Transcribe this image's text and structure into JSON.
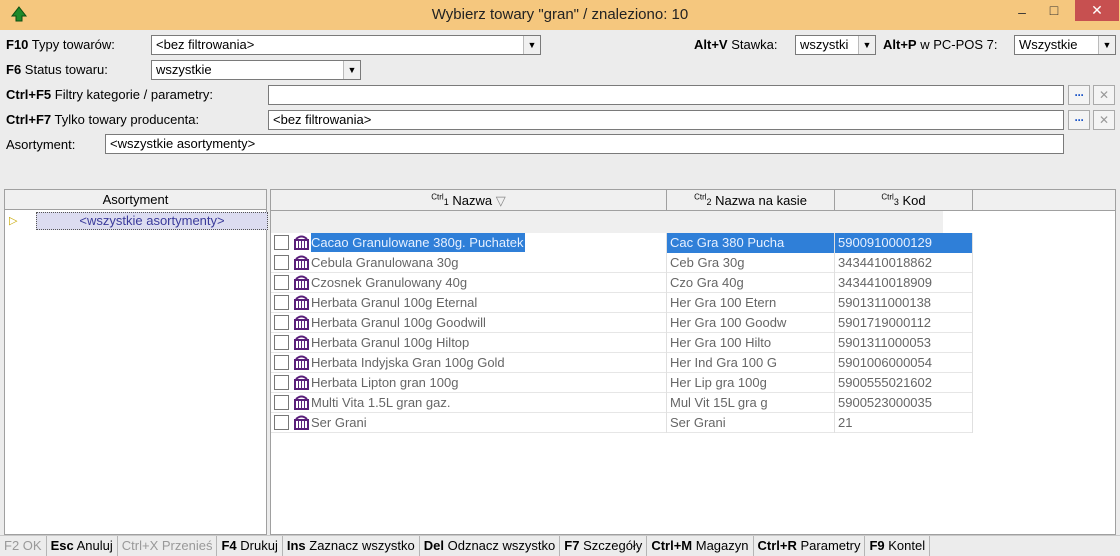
{
  "window": {
    "title": "Wybierz towary \"gran\" / znaleziono: 10",
    "minimize": "–",
    "maximize": "□",
    "close": "✕"
  },
  "filters": {
    "types": {
      "key": "F10",
      "label": "Typy towarów:",
      "value": "<bez filtrowania>"
    },
    "status": {
      "key": "F6",
      "label": "Status towaru:",
      "value": "wszystkie"
    },
    "rate": {
      "key": "Alt+V",
      "label": "Stawka:",
      "value": "wszystki"
    },
    "pcpos": {
      "key": "Alt+P",
      "label": "w PC-POS 7:",
      "value": "Wszystkie"
    },
    "category": {
      "key": "Ctrl+F5",
      "label": "Filtry kategorie / parametry:",
      "value": ""
    },
    "producer": {
      "key": "Ctrl+F7",
      "label": "Tylko towary producenta:",
      "value": "<bez filtrowania>"
    },
    "assortment": {
      "label": "Asortyment:",
      "value": "<wszystkie asortymenty>"
    }
  },
  "tree": {
    "header": "Asortyment",
    "items": [
      {
        "label": "<wszystkie asortymenty>"
      }
    ]
  },
  "grid": {
    "columns": [
      {
        "ctrl": "Ctrl",
        "num": "1",
        "label": "Nazwa",
        "sort": "▽"
      },
      {
        "ctrl": "Ctrl",
        "num": "2",
        "label": "Nazwa na kasie"
      },
      {
        "ctrl": "Ctrl",
        "num": "3",
        "label": "Kod"
      }
    ],
    "rows": [
      {
        "name": "Cacao Granulowane 380g. Puchatek",
        "pos_name": "Cac Gra 380 Pucha",
        "code": "5900910000129",
        "selected": true
      },
      {
        "name": "Cebula Granulowana 30g",
        "pos_name": "Ceb Gra 30g",
        "code": "3434410018862"
      },
      {
        "name": "Czosnek Granulowany 40g",
        "pos_name": "Czo Gra 40g",
        "code": "3434410018909"
      },
      {
        "name": "Herbata Granul 100g Eternal",
        "pos_name": "Her Gra 100 Etern",
        "code": "5901311000138"
      },
      {
        "name": "Herbata Granul 100g Goodwill",
        "pos_name": "Her Gra 100 Goodw",
        "code": "5901719000112"
      },
      {
        "name": "Herbata Granul 100g Hiltop",
        "pos_name": "Her Gra 100 Hilto",
        "code": "5901311000053"
      },
      {
        "name": "Herbata Indyjska Gran 100g Gold",
        "pos_name": "Her Ind Gra 100 G",
        "code": "5901006000054"
      },
      {
        "name": "Herbata Lipton gran 100g",
        "pos_name": "Her Lip gra 100g",
        "code": "5900555021602"
      },
      {
        "name": "Multi Vita 1.5L gran gaz.",
        "pos_name": "Mul Vit 15L gra g",
        "code": "5900523000035"
      },
      {
        "name": "Ser Grani",
        "pos_name": "Ser Grani",
        "code": "21"
      }
    ]
  },
  "fkeys": [
    {
      "key": "F2",
      "label": "OK",
      "disabled": true
    },
    {
      "key": "Esc",
      "label": "Anuluj"
    },
    {
      "key": "Ctrl+X",
      "label": "Przenieś",
      "disabled": true
    },
    {
      "key": "F4",
      "label": "Drukuj"
    },
    {
      "key": "Ins",
      "label": "Zaznacz wszystko"
    },
    {
      "key": "Del",
      "label": "Odznacz wszystko"
    },
    {
      "key": "F7",
      "label": "Szczegóły"
    },
    {
      "key": "Ctrl+M",
      "label": "Magazyn"
    },
    {
      "key": "Ctrl+R",
      "label": "Parametry"
    },
    {
      "key": "F9",
      "label": "Kontel"
    }
  ],
  "colors": {
    "titlebar": "#f5c77e",
    "selection": "#2f7fd8",
    "close_button": "#c75050",
    "tree_item_bg": "#dcdcf0"
  }
}
